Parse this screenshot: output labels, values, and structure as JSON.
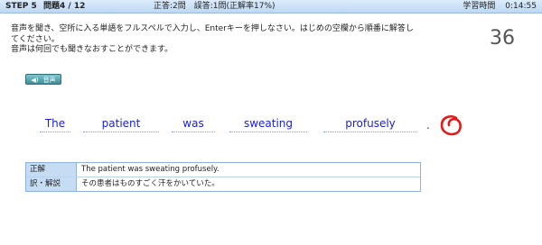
{
  "header": {
    "step": "STEP 5",
    "question": "問題4 / 12",
    "score": "正答:2問　誤答:1問(正解率17%)",
    "time_label": "学習時間",
    "time_value": "0:14:55"
  },
  "instructions": {
    "line1": "音声を聞き、空所に入る単語をフルスペルで入力し、Enterキーを押しなさい。はじめの空欄から順番に解答し",
    "line2": "てください。",
    "line3": "音声は何回でも聞きなおすことができます。"
  },
  "counter": "36",
  "audio_button": {
    "label": "音声",
    "icon": "speaker-icon"
  },
  "answers": [
    "The",
    "patient",
    "was",
    "sweating",
    "profusely"
  ],
  "terminal_punct": ".",
  "result_mark": {
    "type": "correct-circle",
    "color": "#e11a1a"
  },
  "result": {
    "rows": [
      {
        "label": "正解",
        "value": "The patient was sweating profusely."
      },
      {
        "label": "訳・解説",
        "value": "その患者はものすごく汗をかいていた。"
      }
    ]
  }
}
